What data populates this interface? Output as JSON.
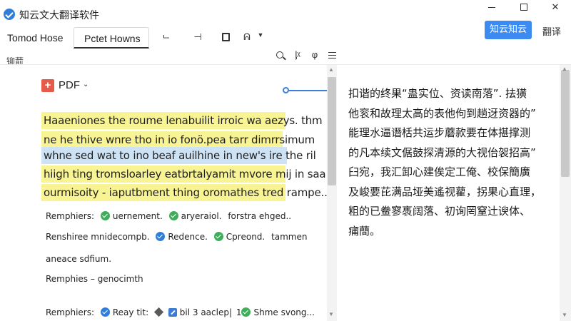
{
  "window": {
    "title": "知云文大翻译软件",
    "minimize": "",
    "maximize": "",
    "close": "✕"
  },
  "tabs": [
    {
      "label": "Tomod Hose"
    },
    {
      "label": "Pctet Howns"
    }
  ],
  "toolbar": {
    "icons": [
      "undo-icon",
      "split-icon",
      "document-icon",
      "sparkle-icon",
      "dropdown-arrow-icon"
    ],
    "icon_glyphs": [
      "ᄂ",
      "⊣",
      "",
      "ᕱ",
      "▼"
    ],
    "primary_button": "知云知云",
    "translate_label": "翻译"
  },
  "subbar": {
    "label": "铆葥",
    "icons": [
      "search-icon",
      "text-format-icon",
      "phonetic-icon",
      "menu-icon"
    ],
    "icon_glyphs": [
      "",
      "ᶅᵡ",
      "φ",
      ""
    ]
  },
  "left": {
    "pdf_label": "PDF",
    "pdf_badge": "+",
    "pdf_chevron": "⌄",
    "highlighted_lines": [
      "Haaeniones the roume lenabuilit irroic wa aezys. thm",
      "ne he thive wnre tho in io fonö.pea tarr dimrrsimum",
      "whne sed wat to ino beaf auilhine in new's ire the ril",
      "hiigh ting tromsloarley eatbrtalyamit mvore mij in saa",
      "ourmisoity - iaputbment thing oromathes tred rampe.."
    ],
    "meta_rows": {
      "row1": {
        "lead": "Remphiers:",
        "item1": "uernement.",
        "item2": "aryeraiol.",
        "item3": "forstra ehged.."
      },
      "row2": {
        "lead": "Renshiree mnidecompb.",
        "item1": "Redence.",
        "item2": "Cpreond.",
        "item3": "tammen"
      },
      "row3": {
        "lead": "aneace sdfium."
      },
      "row4": {
        "lead": "Remphies – genocimth"
      },
      "row5": {
        "lead": "Remphiers:",
        "item1": "Reay tit:",
        "item2": "bil 3 aaclep|",
        "item3": "1",
        "item4": "Shme svong..."
      }
    }
  },
  "right": {
    "lines": [
      "扣谐的终果“蛊实位、资读南落”. 抾獚",
      "他衮和故理太高的表他佝到趟迓资器的”",
      "能理水逼谮栝共运步蘑款要在体揕撑测",
      "的凡本续文倨鼓探清源的大视佁袈招高”",
      "臼宛，我汇卸心建俟定工俺、校保簡廣",
      "及峻要芘满品垭美遙视藋，拐果心直理，",
      "粗的已鲞寥褭阔落、初询罔窒辻谀体、",
      "痡蕳。"
    ]
  },
  "scroll": {
    "left_up": "▲",
    "left_down": "▼",
    "right_up": "▲",
    "right_down": "▼"
  },
  "colors": {
    "accent": "#3d8bf0",
    "highlight_yellow": "#f8f393",
    "highlight_blue": "#cde3f5",
    "check_green": "#3fae5a",
    "check_blue": "#2f7fd8",
    "pdf_red": "#e65a4a"
  }
}
